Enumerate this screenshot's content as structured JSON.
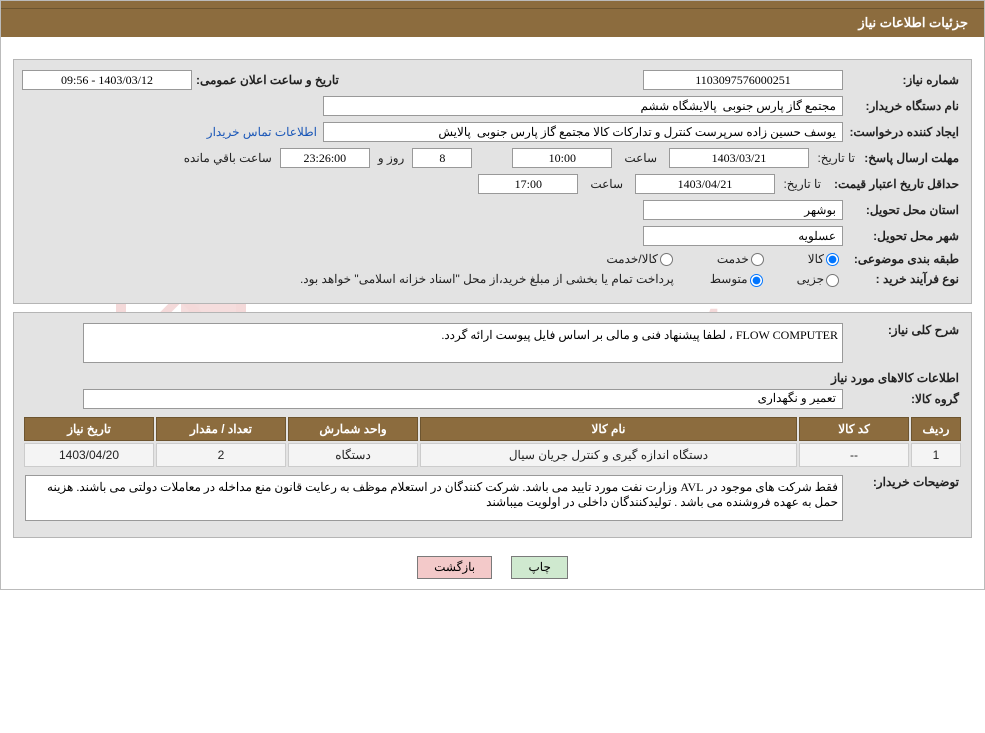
{
  "header": {
    "title": "جزئیات اطلاعات نیاز"
  },
  "row1": {
    "no_label": "شماره نیاز:",
    "no_value": "1103097576000251",
    "announce_label": "تاریخ و ساعت اعلان عمومی:",
    "announce_value": "1403/03/12 - 09:56"
  },
  "buyer": {
    "label": "نام دستگاه خریدار:",
    "value": "مجتمع گاز پارس جنوبی  پالایشگاه ششم"
  },
  "requester": {
    "label": "ایجاد کننده درخواست:",
    "value": "یوسف حسین زاده سرپرست کنترل و تدارکات کالا مجتمع گاز پارس جنوبی  پالایش",
    "link": "اطلاعات تماس خریدار"
  },
  "deadline": {
    "label1": "مهلت ارسال پاسخ:",
    "label_to": "تا تاریخ:",
    "date": "1403/03/21",
    "time_lbl": "ساعت",
    "time": "10:00",
    "days": "8",
    "days_and": "روز و",
    "remain_time": "23:26:00",
    "remain_lbl": "ساعت باقي مانده"
  },
  "validity": {
    "label": "حداقل تاریخ اعتبار قیمت:",
    "label_to": "تا تاریخ:",
    "date": "1403/04/21",
    "time_lbl": "ساعت",
    "time": "17:00"
  },
  "delivery": {
    "province_label": "استان محل تحویل:",
    "province": "بوشهر",
    "city_label": "شهر محل تحویل:",
    "city": "عسلویه"
  },
  "category": {
    "label": "طبقه بندی موضوعی:",
    "opt1": "کالا",
    "opt2": "خدمت",
    "opt3": "کالا/خدمت"
  },
  "process": {
    "label": "نوع فرآیند خرید :",
    "opt1": "جزیی",
    "opt2": "متوسط",
    "note": "پرداخت تمام یا بخشی از مبلغ خرید،از محل \"اسناد خزانه اسلامی\" خواهد بود."
  },
  "need": {
    "label": "شرح کلی نیاز:",
    "value": "FLOW COMPUTER ، لطفا پیشنهاد فنی و مالی بر اساس فایل پیوست ارائه گردد."
  },
  "goods_title": "اطلاعات کالاهای مورد نیاز",
  "group": {
    "label": "گروه کالا:",
    "value": "تعمیر و نگهداری"
  },
  "table": {
    "headers": {
      "row": "ردیف",
      "code": "کد کالا",
      "name": "نام کالا",
      "unit": "واحد شمارش",
      "qty": "تعداد / مقدار",
      "date": "تاریخ نیاز"
    },
    "rows": [
      {
        "row": "1",
        "code": "--",
        "name": "دستگاه اندازه گیری و کنترل جریان سیال",
        "unit": "دستگاه",
        "qty": "2",
        "date": "1403/04/20"
      }
    ]
  },
  "buyer_notes": {
    "label": "توضیحات خریدار:",
    "value": "فقط شرکت های موجود در AVL وزارت نفت مورد تایید می باشد. شرکت کنندگان در استعلام موظف به رعایت قانون منع مداخله در معاملات دولتی می باشند. هزینه حمل به عهده فروشنده می باشد . تولیدکنندگان داخلی در اولویت میباشند"
  },
  "actions": {
    "print": "چاپ",
    "back": "بازگشت"
  }
}
